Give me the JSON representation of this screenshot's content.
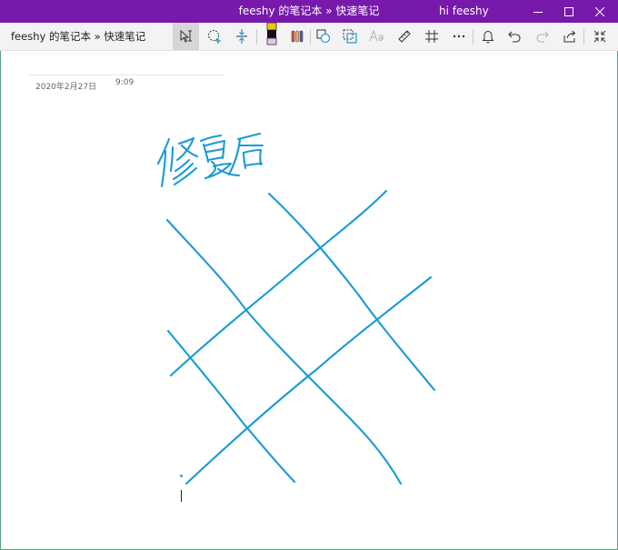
{
  "window": {
    "title": "feeshy 的笔记本 » 快速笔记",
    "account": "hi feeshy",
    "buttons": [
      "minimize-icon",
      "maximize-icon",
      "close-icon"
    ]
  },
  "toolbar": {
    "breadcrumb": "feeshy 的笔记本 » 快速笔记",
    "tools": [
      "type-select-tool-icon",
      "lasso-select-tool-icon",
      "add-space-tool-icon",
      "pen-icon",
      "pen-set-icon",
      "ink-to-shape-icon",
      "lasso-shape-icon",
      "ink-to-text-icon",
      "ruler-icon",
      "more-options-icon",
      "alignment-icon",
      "bell-icon",
      "undo-icon",
      "redo-icon",
      "share-icon",
      "collapse-icon"
    ]
  },
  "page": {
    "date": "2020年2月27日",
    "time": "9:09"
  },
  "colors": {
    "titlebar": "#7719aa",
    "ink": "#1a9ad6",
    "pen_highlight": "#e8c2f0"
  }
}
